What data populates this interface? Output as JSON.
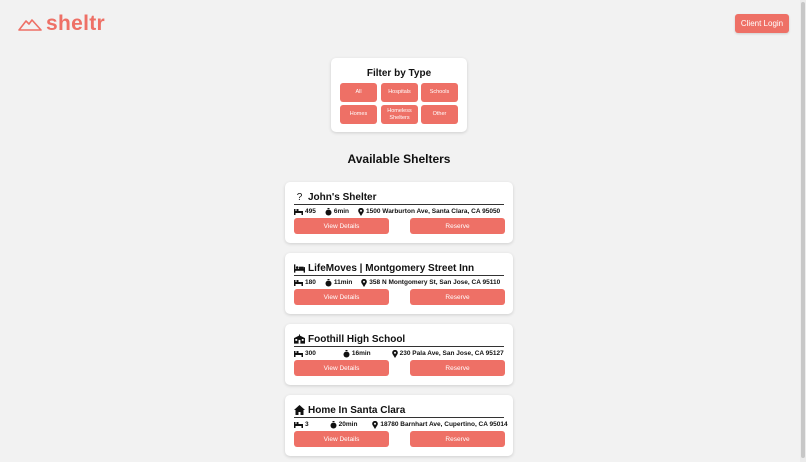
{
  "brand": {
    "name": "sheltr",
    "accent": "#ee7066"
  },
  "header": {
    "login_label": "Client Login"
  },
  "filter": {
    "title": "Filter by Type",
    "options": [
      "All",
      "Hospitals",
      "Schools",
      "Homes",
      "Homeless Shelters",
      "Other"
    ]
  },
  "section_title": "Available Shelters",
  "shelters": [
    {
      "icon": "question-icon",
      "name": "John's Shelter",
      "capacity": "495",
      "time": "6min",
      "address": "1500 Warburton Ave, Santa Clara, CA 95050",
      "details_label": "View Details",
      "reserve_label": "Reserve"
    },
    {
      "icon": "bed-icon",
      "name": "LifeMoves | Montgomery Street Inn",
      "capacity": "180",
      "time": "11min",
      "address": "358 N Montgomery St, San Jose, CA 95110",
      "details_label": "View Details",
      "reserve_label": "Reserve"
    },
    {
      "icon": "school-icon",
      "name": "Foothill High School",
      "capacity": "300",
      "time": "16min",
      "address": "230 Pala Ave, San Jose, CA 95127",
      "details_label": "View Details",
      "reserve_label": "Reserve"
    },
    {
      "icon": "home-icon",
      "name": "Home In Santa Clara",
      "capacity": "3",
      "time": "20min",
      "address": "18780 Barnhart Ave, Cupertino, CA 95014",
      "details_label": "View Details",
      "reserve_label": "Reserve"
    }
  ]
}
